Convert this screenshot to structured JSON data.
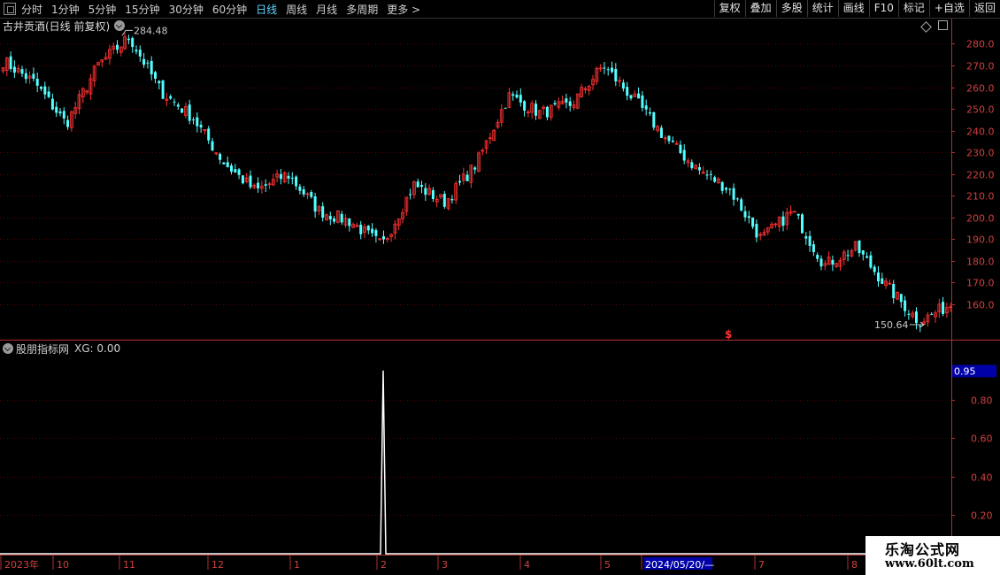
{
  "toolbar": {
    "periods": [
      "分时",
      "1分钟",
      "5分钟",
      "15分钟",
      "30分钟",
      "60分钟",
      "日线",
      "周线",
      "月线",
      "多周期",
      "更多 >"
    ],
    "active_period": "日线",
    "buttons": [
      "复权",
      "叠加",
      "多股",
      "统计",
      "画线",
      "F10",
      "标记",
      "+自选",
      "返回"
    ]
  },
  "stock_title": "古井贡酒(日线 前复权)",
  "indicator": {
    "name": "股朋指标网",
    "label": "XG: 0.00"
  },
  "watermark": {
    "line1": "乐淘公式网",
    "line2": "www.60lt.com"
  },
  "colors": {
    "up": "#ff3232",
    "down": "#54ffff",
    "axis": "#b03030",
    "grid": "#5a0000",
    "highlight": "#0000a8"
  },
  "chart_data": [
    {
      "type": "candlestick",
      "title": "古井贡酒(日线 前复权)",
      "ylim": [
        150,
        289
      ],
      "yticks": [
        160,
        170,
        180,
        190,
        200,
        210,
        220,
        230,
        240,
        250,
        260,
        270,
        280
      ],
      "ytick_labels": [
        "160.0",
        "170.0",
        "180.0",
        "190.0",
        "200.0",
        "210.0",
        "220.0",
        "230.0",
        "240.0",
        "250.0",
        "260.0",
        "270.0",
        "280.0"
      ],
      "x_axis_labels": [
        "2023年",
        "10",
        "11",
        "12",
        "1",
        "2",
        "3",
        "4",
        "5",
        "2024/05/20/—",
        "7",
        "8"
      ],
      "highlighted_date": "2024/05/20/—",
      "annotations": [
        {
          "text": "284.48",
          "value": 284.48
        },
        {
          "text": "150.64",
          "value": 150.64
        }
      ],
      "marker": "$",
      "anchors": [
        [
          "2023-08",
          272
        ],
        [
          "2023-09",
          262
        ],
        [
          "2023-10",
          243
        ],
        [
          "2023-11a",
          270
        ],
        [
          "2023-11b",
          283
        ],
        [
          "2023-11c",
          258
        ],
        [
          "2023-12a",
          246
        ],
        [
          "2023-12b",
          225
        ],
        [
          "2023-12c",
          212
        ],
        [
          "2024-01a",
          220
        ],
        [
          "2024-01b",
          203
        ],
        [
          "2024-01c",
          198
        ],
        [
          "2024-02",
          187
        ],
        [
          "2024-02b",
          215
        ],
        [
          "2024-03a",
          207
        ],
        [
          "2024-03b",
          225
        ],
        [
          "2024-04a",
          256
        ],
        [
          "2024-04b",
          248
        ],
        [
          "2024-05a",
          252
        ],
        [
          "2024-05b",
          270
        ],
        [
          "2024-05c",
          254
        ],
        [
          "2024-06a",
          236
        ],
        [
          "2024-06b",
          222
        ],
        [
          "2024-07a",
          213
        ],
        [
          "2024-07b",
          190
        ],
        [
          "2024-07c",
          203
        ],
        [
          "2024-08a",
          178
        ],
        [
          "2024-08b",
          186
        ],
        [
          "2024-08c",
          168
        ],
        [
          "2024-08d",
          152
        ],
        [
          "2024-08e",
          160
        ]
      ]
    },
    {
      "type": "line",
      "series": [
        {
          "name": "XG",
          "values_peak": 0.95,
          "baseline": 0.0
        }
      ],
      "ylim": [
        0,
        0.95
      ],
      "yticks": [
        0.2,
        0.4,
        0.6,
        0.8,
        0.95
      ],
      "ytick_labels": [
        "0.20",
        "0.40",
        "0.60",
        "0.80",
        "0.95"
      ],
      "spike_at": "2024-02"
    }
  ]
}
